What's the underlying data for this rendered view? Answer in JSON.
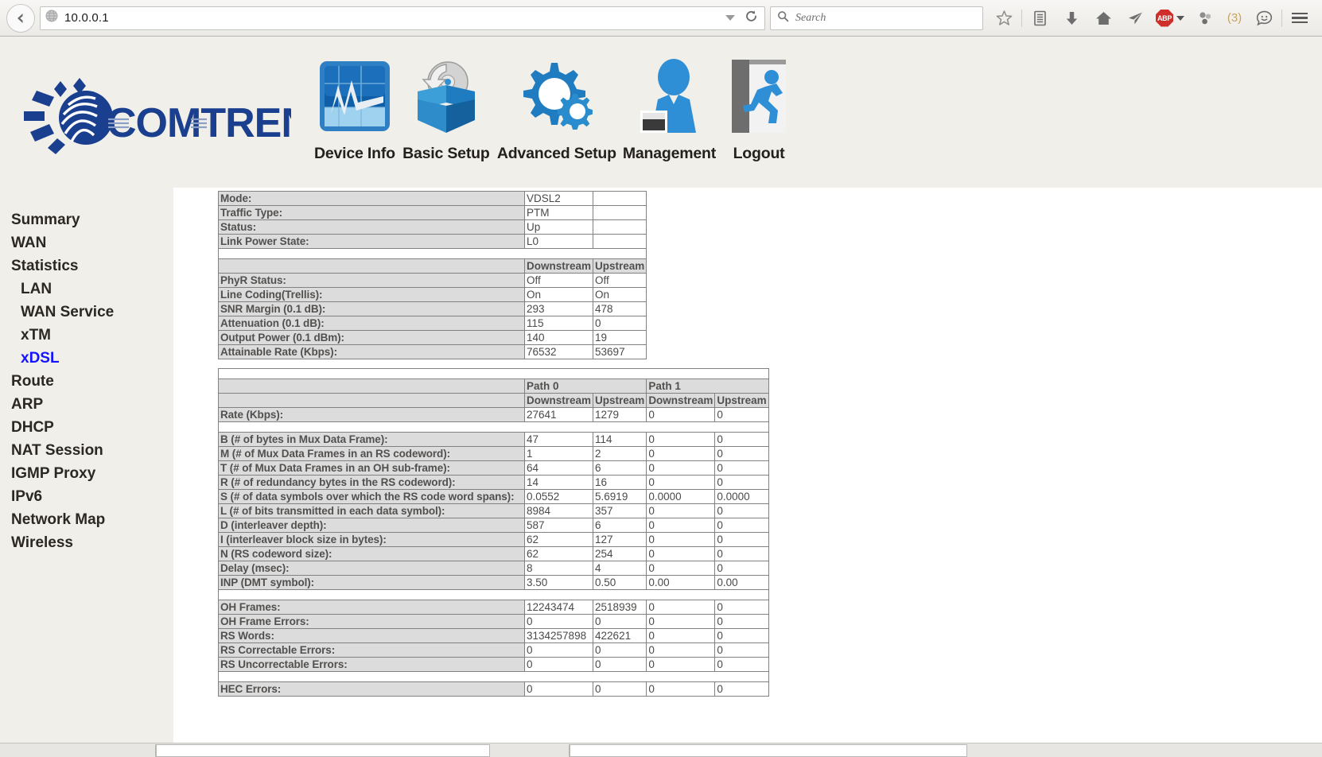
{
  "browser": {
    "back_icon": "back-arrow-icon",
    "url": "10.0.0.1",
    "site_icon": "globe-icon",
    "dropdown_icon": "chevron-down-icon",
    "reload_icon": "reload-icon",
    "search_placeholder": "Search",
    "search_icon": "search-icon",
    "toolbar_icons": [
      {
        "name": "bookmark-star-icon",
        "label": ""
      },
      {
        "name": "reading-list-icon",
        "label": ""
      },
      {
        "name": "downloads-icon",
        "label": ""
      },
      {
        "name": "home-icon",
        "label": ""
      },
      {
        "name": "send-tab-icon",
        "label": ""
      },
      {
        "name": "adblock-plus-icon",
        "label": "ABP"
      },
      {
        "name": "ghostery-icon",
        "label": ""
      }
    ],
    "notification_count": "(3)",
    "feedback_icon": "smiley-chat-icon",
    "menu_icon": "hamburger-menu-icon"
  },
  "brand": {
    "name": "COMTREND",
    "logo_icon": "comtrend-sun-globe-logo",
    "logo_color": "#1b3f8f"
  },
  "nav": [
    {
      "label": "Device Info",
      "icon": "device-info-chart-icon"
    },
    {
      "label": "Basic Setup",
      "icon": "basic-setup-box-disc-icon"
    },
    {
      "label": "Advanced Setup",
      "icon": "advanced-setup-gears-icon"
    },
    {
      "label": "Management",
      "icon": "management-person-icon"
    },
    {
      "label": "Logout",
      "icon": "logout-door-running-icon"
    }
  ],
  "sidebar": {
    "items": [
      {
        "label": "Summary",
        "sub": false,
        "active": false
      },
      {
        "label": "WAN",
        "sub": false,
        "active": false
      },
      {
        "label": "Statistics",
        "sub": false,
        "active": false
      },
      {
        "label": "LAN",
        "sub": true,
        "active": false
      },
      {
        "label": "WAN Service",
        "sub": true,
        "active": false
      },
      {
        "label": "xTM",
        "sub": true,
        "active": false
      },
      {
        "label": "xDSL",
        "sub": true,
        "active": true
      },
      {
        "label": "Route",
        "sub": false,
        "active": false
      },
      {
        "label": "ARP",
        "sub": false,
        "active": false
      },
      {
        "label": "DHCP",
        "sub": false,
        "active": false
      },
      {
        "label": "NAT Session",
        "sub": false,
        "active": false
      },
      {
        "label": "IGMP Proxy",
        "sub": false,
        "active": false
      },
      {
        "label": "IPv6",
        "sub": false,
        "active": false
      },
      {
        "label": "Network Map",
        "sub": false,
        "active": false
      },
      {
        "label": "Wireless",
        "sub": false,
        "active": false
      }
    ],
    "active_color": "#1414ff"
  },
  "xdsl": {
    "link_status": [
      {
        "label": "Mode:",
        "value": "VDSL2"
      },
      {
        "label": "Traffic Type:",
        "value": "PTM"
      },
      {
        "label": "Status:",
        "value": "Up"
      },
      {
        "label": "Link Power State:",
        "value": "L0"
      }
    ],
    "stream_headers": [
      "Downstream",
      "Upstream"
    ],
    "line_stats": [
      {
        "label": "PhyR Status:",
        "downstream": "Off",
        "upstream": "Off"
      },
      {
        "label": "Line Coding(Trellis):",
        "downstream": "On",
        "upstream": "On"
      },
      {
        "label": "SNR Margin (0.1 dB):",
        "downstream": "293",
        "upstream": "478"
      },
      {
        "label": "Attenuation (0.1 dB):",
        "downstream": "115",
        "upstream": "0"
      },
      {
        "label": "Output Power (0.1 dBm):",
        "downstream": "140",
        "upstream": "19"
      },
      {
        "label": "Attainable Rate (Kbps):",
        "downstream": "76532",
        "upstream": "53697"
      }
    ],
    "path_headers": [
      "Path 0",
      "Path 1"
    ],
    "path_stream_headers": [
      "Downstream",
      "Upstream",
      "Downstream",
      "Upstream"
    ],
    "rate_row": {
      "label": "Rate (Kbps):",
      "values": [
        "27641",
        "1279",
        "0",
        "0"
      ]
    },
    "framing": [
      {
        "label": "B (# of bytes in Mux Data Frame):",
        "values": [
          "47",
          "114",
          "0",
          "0"
        ]
      },
      {
        "label": "M (# of Mux Data Frames in an RS codeword):",
        "values": [
          "1",
          "2",
          "0",
          "0"
        ]
      },
      {
        "label": "T (# of Mux Data Frames in an OH sub-frame):",
        "values": [
          "64",
          "6",
          "0",
          "0"
        ]
      },
      {
        "label": "R (# of redundancy bytes in the RS codeword):",
        "values": [
          "14",
          "16",
          "0",
          "0"
        ]
      },
      {
        "label": "S (# of data symbols over which the RS code word spans):",
        "values": [
          "0.0552",
          "5.6919",
          "0.0000",
          "0.0000"
        ]
      },
      {
        "label": "L (# of bits transmitted in each data symbol):",
        "values": [
          "8984",
          "357",
          "0",
          "0"
        ]
      },
      {
        "label": "D (interleaver depth):",
        "values": [
          "587",
          "6",
          "0",
          "0"
        ]
      },
      {
        "label": "I (interleaver block size in bytes):",
        "values": [
          "62",
          "127",
          "0",
          "0"
        ]
      },
      {
        "label": "N (RS codeword size):",
        "values": [
          "62",
          "254",
          "0",
          "0"
        ]
      },
      {
        "label": "Delay (msec):",
        "values": [
          "8",
          "4",
          "0",
          "0"
        ]
      },
      {
        "label": "INP (DMT symbol):",
        "values": [
          "3.50",
          "0.50",
          "0.00",
          "0.00"
        ]
      }
    ],
    "counters": [
      {
        "label": "OH Frames:",
        "values": [
          "12243474",
          "2518939",
          "0",
          "0"
        ]
      },
      {
        "label": "OH Frame Errors:",
        "values": [
          "0",
          "0",
          "0",
          "0"
        ]
      },
      {
        "label": "RS Words:",
        "values": [
          "3134257898",
          "422621",
          "0",
          "0"
        ]
      },
      {
        "label": "RS Correctable Errors:",
        "values": [
          "0",
          "0",
          "0",
          "0"
        ]
      },
      {
        "label": "RS Uncorrectable Errors:",
        "values": [
          "0",
          "0",
          "0",
          "0"
        ]
      }
    ],
    "hec": [
      {
        "label": "HEC Errors:",
        "values": [
          "0",
          "0",
          "0",
          "0"
        ]
      }
    ]
  }
}
